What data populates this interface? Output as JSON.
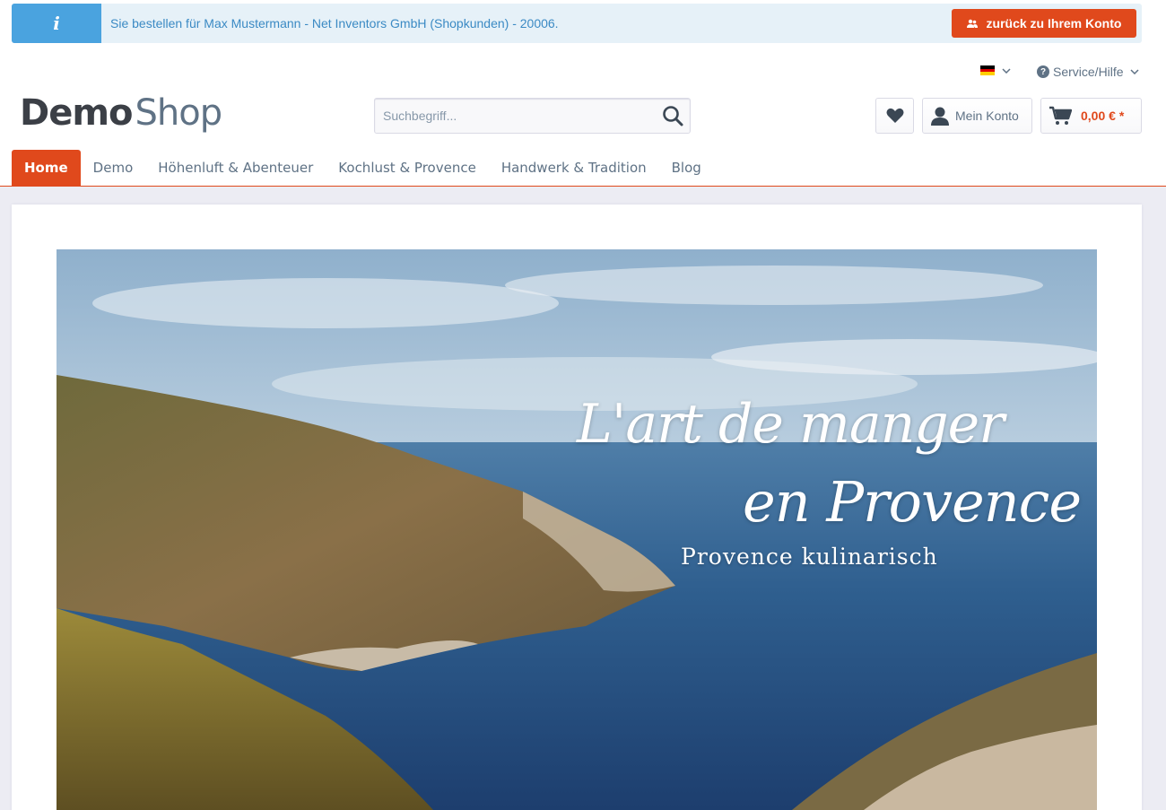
{
  "notice": {
    "icon": "info-icon",
    "icon_glyph": "i",
    "text": "Sie bestellen für Max Mustermann - Net Inventors GmbH (Shopkunden) - 20006.",
    "back_button": "zurück zu Ihrem Konto"
  },
  "meta": {
    "language_flag": "de-flag-icon",
    "service_label": "Service/Hilfe"
  },
  "logo": {
    "part1": "Demo",
    "part2": "Shop"
  },
  "search": {
    "placeholder": "Suchbegriff..."
  },
  "header": {
    "account_label": "Mein Konto",
    "cart_amount": "0,00 € *"
  },
  "nav": {
    "items": [
      {
        "label": "Home",
        "active": true
      },
      {
        "label": "Demo"
      },
      {
        "label": "Höhenluft & Abenteuer"
      },
      {
        "label": "Kochlust & Provence"
      },
      {
        "label": "Handwerk & Tradition"
      },
      {
        "label": "Blog"
      }
    ]
  },
  "banner": {
    "title_line1": "L'art de manger",
    "title_line2": "en Provence",
    "subtitle": "Provence kulinarisch"
  },
  "colors": {
    "accent": "#e0491c",
    "info_bg": "#e6f1f8",
    "info_icon_bg": "#4aa3df",
    "text": "#5f7285",
    "content_bg": "#ececf3"
  }
}
